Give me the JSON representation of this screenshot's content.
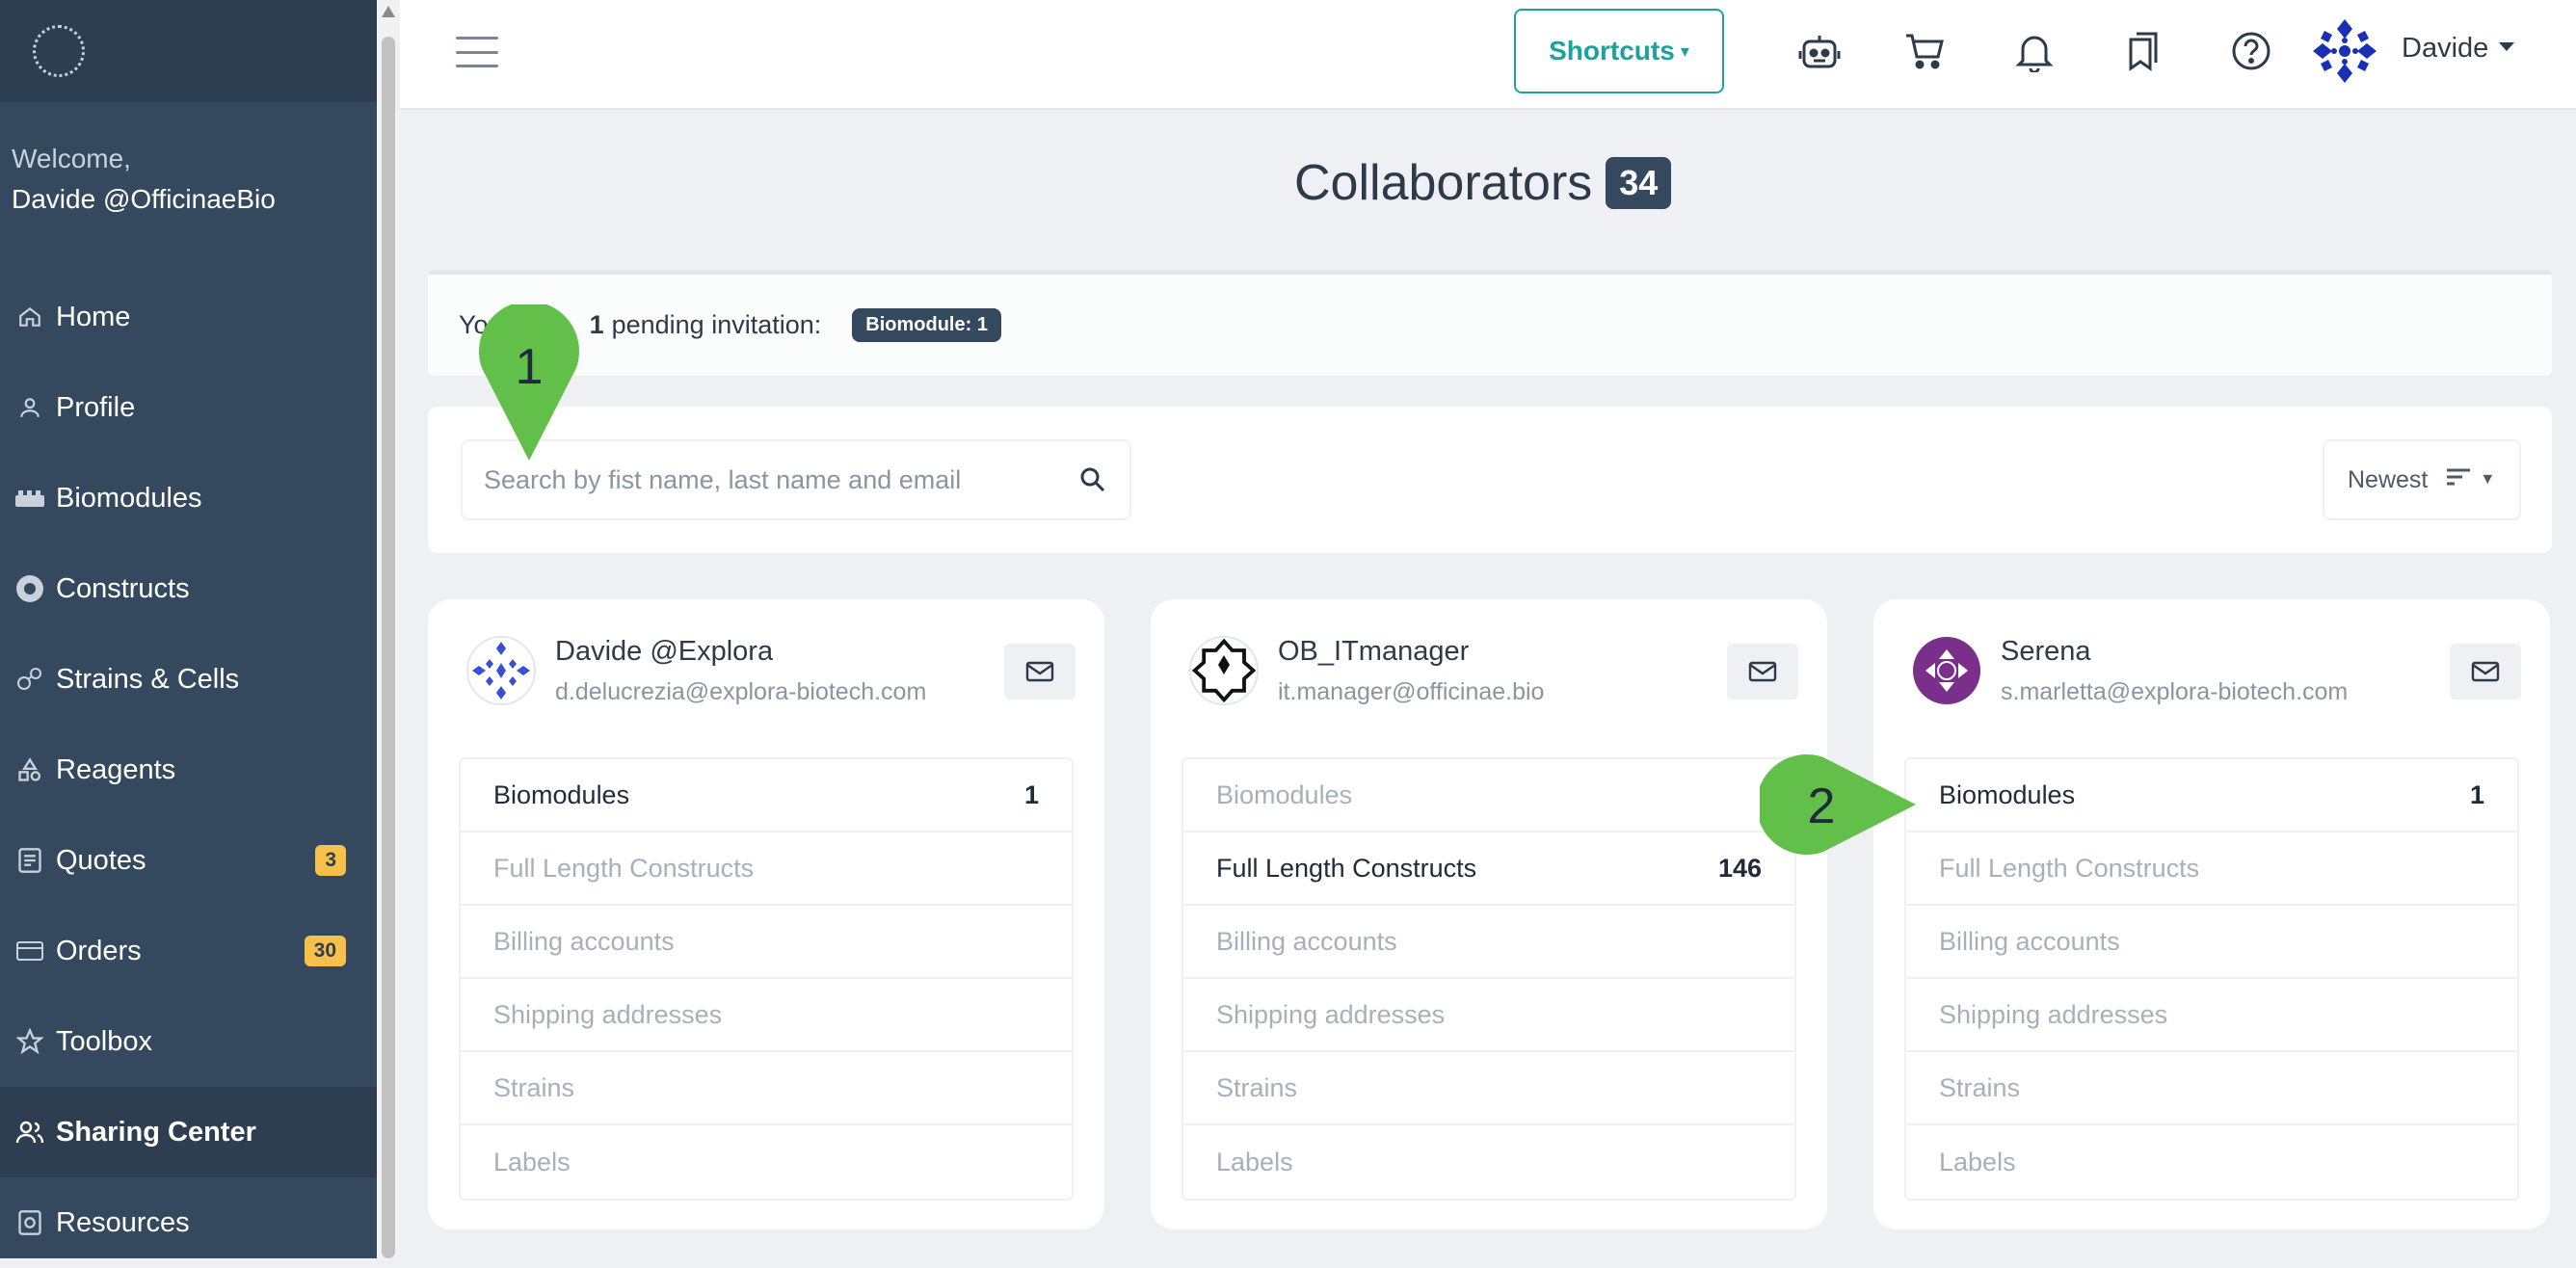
{
  "sidebar": {
    "welcome_line1": "Welcome,",
    "welcome_line2": "Davide @OfficinaeBio",
    "items": [
      {
        "label": "Home",
        "icon": "home-icon"
      },
      {
        "label": "Profile",
        "icon": "person-icon"
      },
      {
        "label": "Biomodules",
        "icon": "biomodules-icon"
      },
      {
        "label": "Constructs",
        "icon": "constructs-icon"
      },
      {
        "label": "Strains & Cells",
        "icon": "strains-icon"
      },
      {
        "label": "Reagents",
        "icon": "reagents-icon"
      },
      {
        "label": "Quotes",
        "icon": "document-icon",
        "badge": "3"
      },
      {
        "label": "Orders",
        "icon": "card-icon",
        "badge": "30"
      },
      {
        "label": "Toolbox",
        "icon": "star-icon"
      },
      {
        "label": "Sharing Center",
        "icon": "people-icon",
        "active": true
      },
      {
        "label": "Resources",
        "icon": "resources-icon"
      }
    ]
  },
  "topbar": {
    "shortcuts_label": "Shortcuts",
    "user_name": "Davide"
  },
  "page": {
    "title": "Collaborators",
    "count": "34",
    "invite_prefix": "You",
    "invite_count": "1",
    "invite_text": "pending invitation:",
    "invite_badge": "Biomodule: 1"
  },
  "filter": {
    "search_placeholder": "Search by fist name, last name and email",
    "sort_label": "Newest"
  },
  "cards": [
    {
      "name": "Davide @Explora",
      "email": "d.delucrezia@explora-biotech.com",
      "rows": [
        {
          "label": "Biomodules",
          "value": "1",
          "on": true
        },
        {
          "label": "Full Length Constructs",
          "value": "",
          "on": false
        },
        {
          "label": "Billing accounts",
          "value": "",
          "on": false
        },
        {
          "label": "Shipping addresses",
          "value": "",
          "on": false
        },
        {
          "label": "Strains",
          "value": "",
          "on": false
        },
        {
          "label": "Labels",
          "value": "",
          "on": false
        }
      ]
    },
    {
      "name": "OB_ITmanager",
      "email": "it.manager@officinae.bio",
      "rows": [
        {
          "label": "Biomodules",
          "value": "",
          "on": false
        },
        {
          "label": "Full Length Constructs",
          "value": "146",
          "on": true
        },
        {
          "label": "Billing accounts",
          "value": "",
          "on": false
        },
        {
          "label": "Shipping addresses",
          "value": "",
          "on": false
        },
        {
          "label": "Strains",
          "value": "",
          "on": false
        },
        {
          "label": "Labels",
          "value": "",
          "on": false
        }
      ]
    },
    {
      "name": "Serena",
      "email": "s.marletta@explora-biotech.com",
      "rows": [
        {
          "label": "Biomodules",
          "value": "1",
          "on": true
        },
        {
          "label": "Full Length Constructs",
          "value": "",
          "on": false
        },
        {
          "label": "Billing accounts",
          "value": "",
          "on": false
        },
        {
          "label": "Shipping addresses",
          "value": "",
          "on": false
        },
        {
          "label": "Strains",
          "value": "",
          "on": false
        },
        {
          "label": "Labels",
          "value": "",
          "on": false
        }
      ]
    }
  ],
  "annotations": {
    "marker1": "1",
    "marker2": "2"
  },
  "colors": {
    "sidebar": "#34495e",
    "accent": "#1aa39a",
    "badge": "#f6c04a",
    "marker": "#62c04a"
  }
}
